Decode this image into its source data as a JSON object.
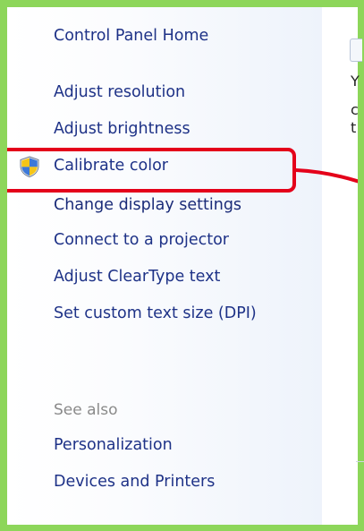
{
  "sidebar": {
    "home_link": "Control Panel Home",
    "tasks": [
      "Adjust resolution",
      "Adjust brightness",
      "Calibrate color",
      "Change display settings",
      "Connect to a projector",
      "Adjust ClearType text",
      "Set custom text size (DPI)"
    ],
    "see_also_label": "See also",
    "see_also_links": [
      "Personalization",
      "Devices and Printers"
    ]
  },
  "main": {
    "partial_chars": [
      "Y",
      "c",
      "t"
    ]
  },
  "colors": {
    "link": "#1e3287",
    "see_also": "#8a8a8a",
    "highlight": "#e4001a",
    "border": "#8dd65a"
  },
  "icons": {
    "calibrate_color": "uac-shield-icon"
  }
}
